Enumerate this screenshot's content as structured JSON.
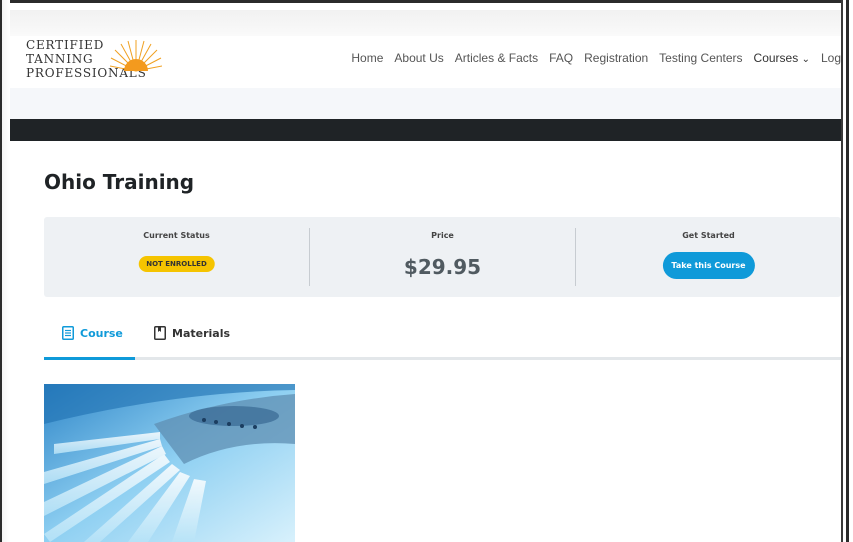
{
  "logo": {
    "line1": "CERTIFIED",
    "line2": "TANNING",
    "line3": "PROFESSIONALS"
  },
  "nav": {
    "items": [
      "Home",
      "About Us",
      "Articles & Facts",
      "FAQ",
      "Registration",
      "Testing Centers"
    ],
    "courses": "Courses",
    "courses_caret": "⌄",
    "login": "Log"
  },
  "page": {
    "title": "Ohio Training"
  },
  "status": {
    "current_status_label": "Current Status",
    "current_status_badge": "NOT ENROLLED",
    "price_label": "Price",
    "price": "$29.95",
    "get_started_label": "Get Started",
    "take_course_button": "Take this Course"
  },
  "tabs": {
    "course": "Course",
    "materials": "Materials"
  },
  "colors": {
    "accent": "#0f9ad9",
    "badge": "#f5c400",
    "dark_band": "#1f2326",
    "status_bg": "#eef1f4"
  },
  "icons": {
    "course_tab": "document-icon",
    "materials_tab": "bookmark-icon"
  }
}
